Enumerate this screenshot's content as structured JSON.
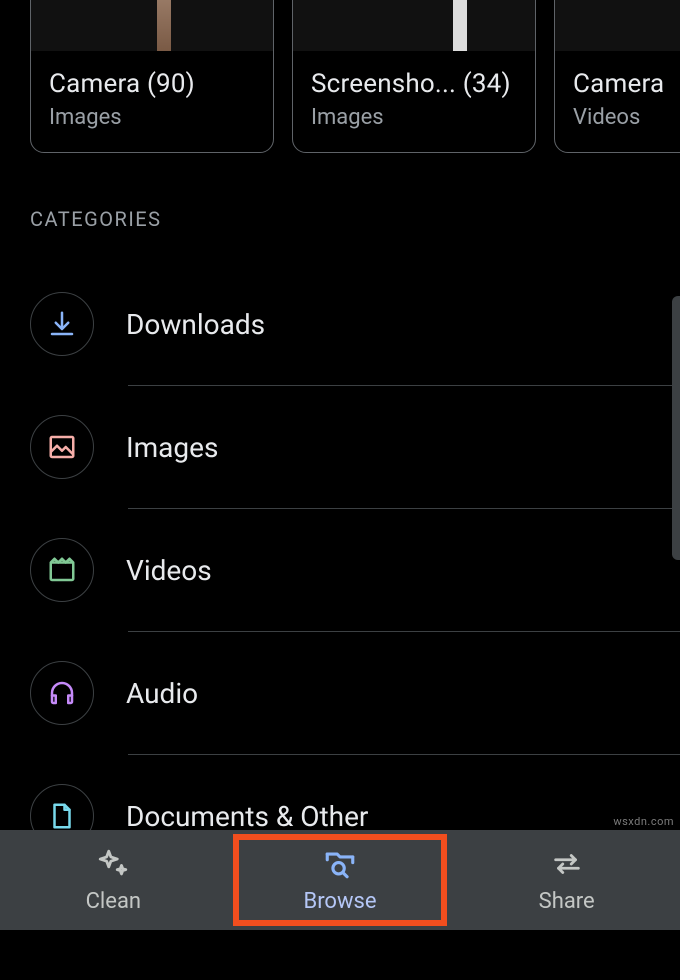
{
  "cards": [
    {
      "title": "Camera (90)",
      "subtitle": "Images"
    },
    {
      "title": "Screensho... (34)",
      "subtitle": "Images"
    },
    {
      "title": "Camera",
      "subtitle": "Videos"
    }
  ],
  "sections": {
    "categories_header": "CATEGORIES"
  },
  "categories": [
    {
      "label": "Downloads",
      "icon": "download",
      "color": "#8ab4f8"
    },
    {
      "label": "Images",
      "icon": "image",
      "color": "#f6aea9"
    },
    {
      "label": "Videos",
      "icon": "video",
      "color": "#81c995"
    },
    {
      "label": "Audio",
      "icon": "audio",
      "color": "#c58af9"
    },
    {
      "label": "Documents & Other",
      "icon": "document",
      "color": "#78d9ec"
    }
  ],
  "nav": {
    "clean": "Clean",
    "browse": "Browse",
    "share": "Share"
  },
  "watermark": "wsxdn.com"
}
